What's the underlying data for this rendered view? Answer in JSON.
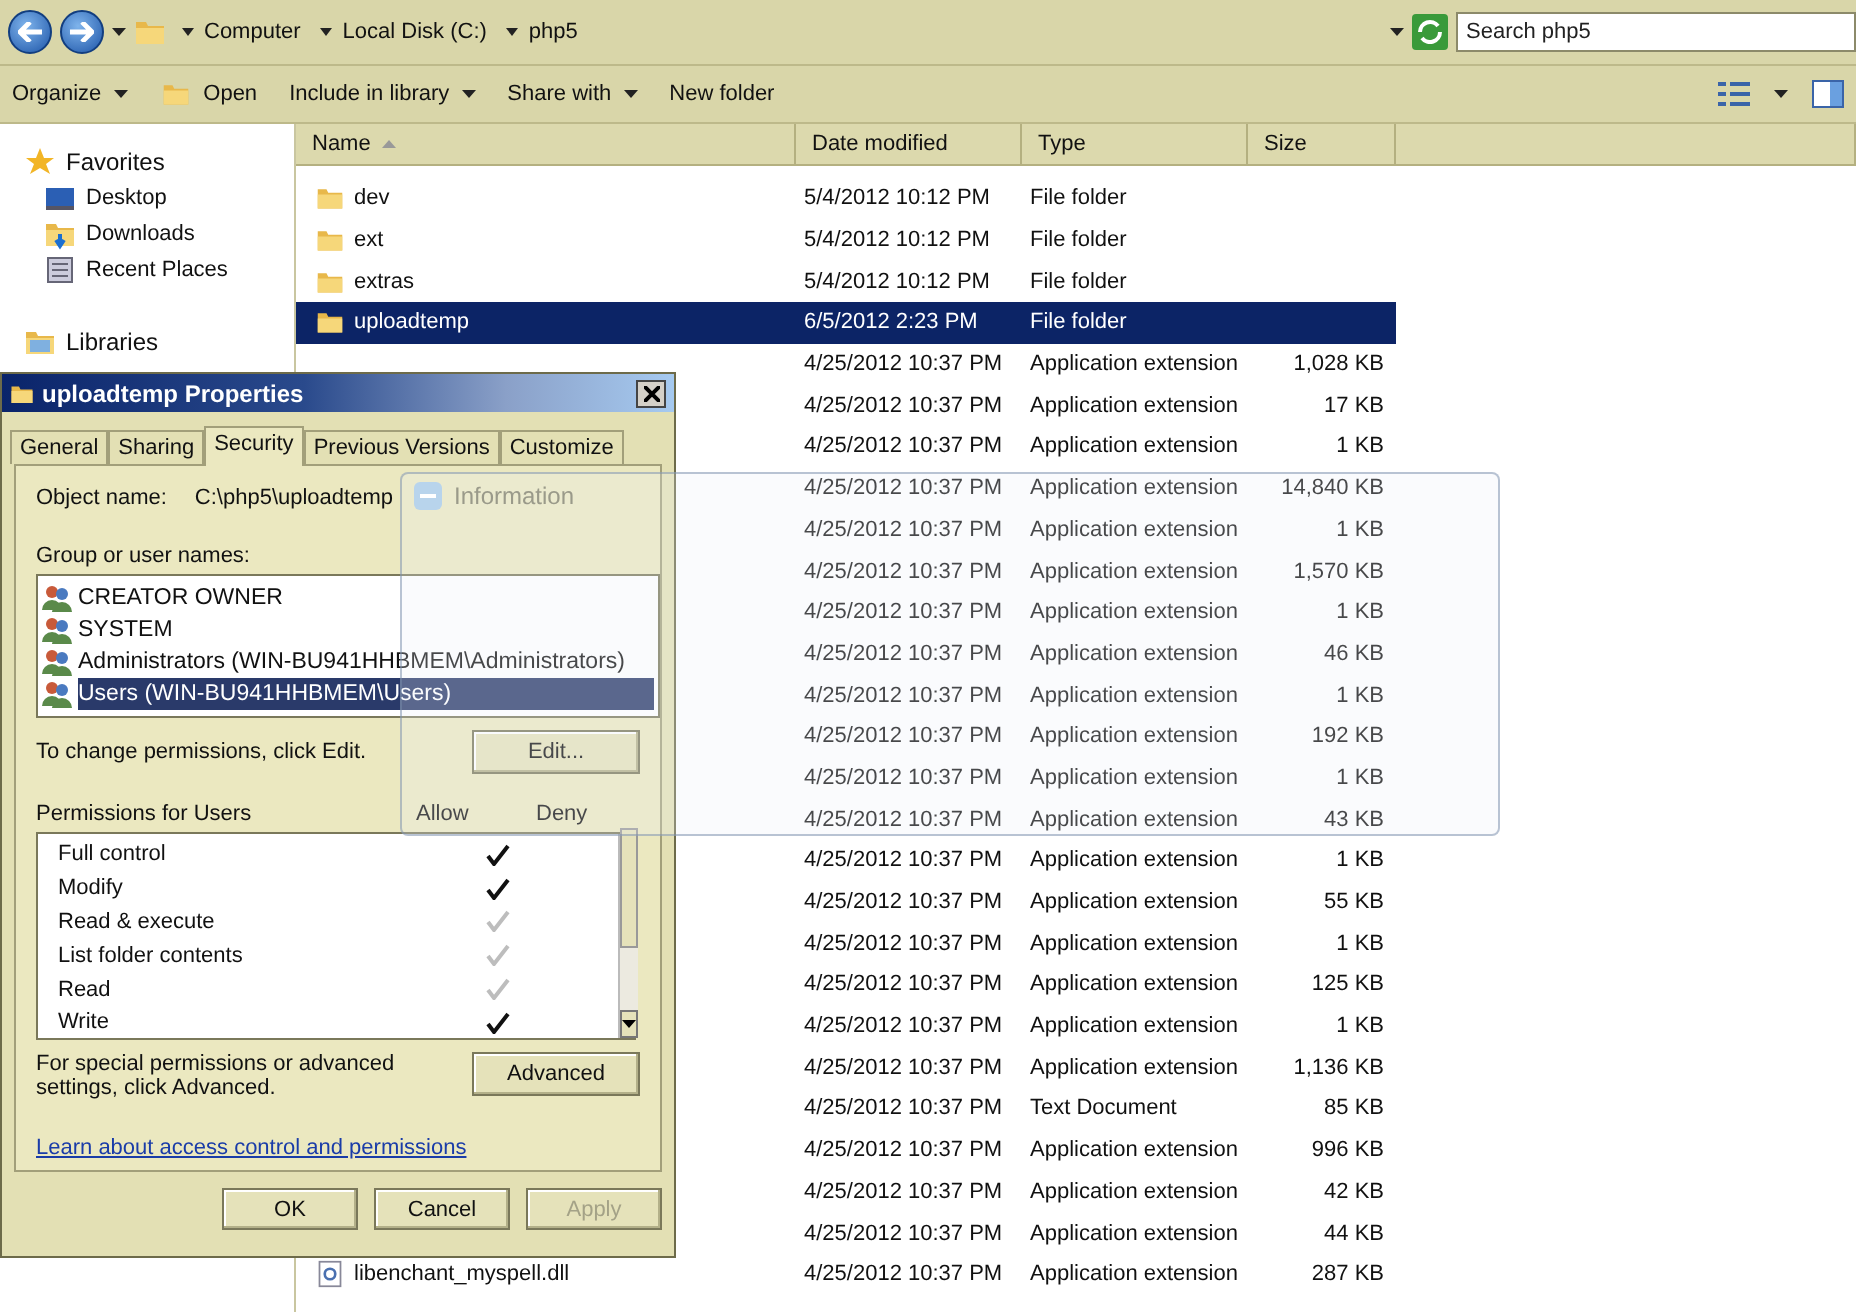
{
  "explorer": {
    "crumbs": [
      "Computer",
      "Local Disk (C:)",
      "php5"
    ],
    "search": {
      "placeholder": "Search php5"
    },
    "toolbar": [
      {
        "label": "Organize",
        "kind": "menu"
      },
      {
        "label": "Open",
        "kind": "icon"
      },
      {
        "label": "Include in library",
        "kind": "menu"
      },
      {
        "label": "Share with",
        "kind": "menu"
      },
      {
        "label": "New folder",
        "kind": "plain"
      }
    ],
    "nav": [
      {
        "label": "Favorites",
        "kind": "group"
      },
      {
        "label": "Desktop",
        "kind": "item"
      },
      {
        "label": "Downloads",
        "kind": "item"
      },
      {
        "label": "Recent Places",
        "kind": "item"
      },
      {
        "label": "Libraries",
        "kind": "group"
      }
    ],
    "columns": [
      {
        "label": "Name",
        "sorted": true
      },
      {
        "label": "Date modified",
        "sorted": false
      },
      {
        "label": "Type",
        "sorted": false
      },
      {
        "label": "Size",
        "sorted": false
      }
    ],
    "rows": [
      {
        "name": "dev",
        "kind": "folder",
        "date": "5/4/2012 10:12 PM",
        "type": "File folder",
        "selected": false
      },
      {
        "name": "ext",
        "kind": "folder",
        "date": "5/4/2012 10:12 PM",
        "type": "File folder",
        "selected": false
      },
      {
        "name": "extras",
        "kind": "folder",
        "date": "5/4/2012 10:12 PM",
        "type": "File folder",
        "selected": false
      },
      {
        "name": "uploadtemp",
        "kind": "folder",
        "date": "6/5/2012 2:23 PM",
        "type": "File folder",
        "selected": true
      },
      {
        "date": "4/25/2012 10:37 PM",
        "type": "Application extension",
        "size": "1,028 KB",
        "selected": false
      },
      {
        "date": "4/25/2012 10:37 PM",
        "type": "Application extension",
        "size": "17 KB",
        "selected": false
      },
      {
        "date": "4/25/2012 10:37 PM",
        "type": "Application extension",
        "size": "1 KB",
        "selected": false
      },
      {
        "date": "4/25/2012 10:37 PM",
        "type": "Application extension",
        "size": "14,840 KB",
        "selected": false
      },
      {
        "date": "4/25/2012 10:37 PM",
        "type": "Application extension",
        "size": "1 KB",
        "selected": false
      },
      {
        "date": "4/25/2012 10:37 PM",
        "type": "Application extension",
        "size": "1,570 KB",
        "selected": false
      },
      {
        "date": "4/25/2012 10:37 PM",
        "type": "Application extension",
        "size": "1 KB",
        "selected": false
      },
      {
        "date": "4/25/2012 10:37 PM",
        "type": "Application extension",
        "size": "46 KB",
        "selected": false
      },
      {
        "date": "4/25/2012 10:37 PM",
        "type": "Application extension",
        "size": "1 KB",
        "selected": false
      },
      {
        "date": "4/25/2012 10:37 PM",
        "type": "Application extension",
        "size": "192 KB",
        "selected": false
      },
      {
        "date": "4/25/2012 10:37 PM",
        "type": "Application extension",
        "size": "1 KB",
        "selected": false
      },
      {
        "date": "4/25/2012 10:37 PM",
        "type": "Application extension",
        "size": "43 KB",
        "selected": false
      },
      {
        "date": "4/25/2012 10:37 PM",
        "type": "Application extension",
        "size": "1 KB",
        "selected": false
      },
      {
        "date": "4/25/2012 10:37 PM",
        "type": "Application extension",
        "size": "55 KB",
        "selected": false
      },
      {
        "date": "4/25/2012 10:37 PM",
        "type": "Application extension",
        "size": "1 KB",
        "selected": false
      },
      {
        "date": "4/25/2012 10:37 PM",
        "type": "Application extension",
        "size": "125 KB",
        "selected": false
      },
      {
        "date": "4/25/2012 10:37 PM",
        "type": "Application extension",
        "size": "1 KB",
        "selected": false
      },
      {
        "date": "4/25/2012 10:37 PM",
        "type": "Application extension",
        "size": "1,136 KB",
        "selected": false
      },
      {
        "date": "4/25/2012 10:37 PM",
        "type": "Text Document",
        "size": "85 KB",
        "selected": false
      },
      {
        "date": "4/25/2012 10:37 PM",
        "type": "Application extension",
        "size": "996 KB",
        "selected": false
      },
      {
        "date": "4/25/2012 10:37 PM",
        "type": "Application extension",
        "size": "42 KB",
        "selected": false
      },
      {
        "date": "4/25/2012 10:37 PM",
        "type": "Application extension",
        "size": "44 KB",
        "selected": false
      },
      {
        "name": "libenchant_myspell.dll",
        "kind": "dll",
        "date": "4/25/2012 10:37 PM",
        "type": "Application extension",
        "size": "287 KB",
        "selected": false
      }
    ]
  },
  "properties": {
    "title": "uploadtemp Properties",
    "tabs": [
      {
        "label": "General",
        "selected": false
      },
      {
        "label": "Sharing",
        "selected": false
      },
      {
        "label": "Security",
        "selected": true
      },
      {
        "label": "Previous Versions",
        "selected": false
      },
      {
        "label": "Customize",
        "selected": false
      }
    ],
    "object_label": "Object name:",
    "object_value": "C:\\php5\\uploadtemp",
    "group_label": "Group or user names:",
    "users": [
      {
        "name": "CREATOR OWNER",
        "selected": false
      },
      {
        "name": "SYSTEM",
        "selected": false
      },
      {
        "name": "Administrators (WIN-BU941HHBMEM\\Administrators)",
        "selected": false
      },
      {
        "name": "Users (WIN-BU941HHBMEM\\Users)",
        "selected": true
      }
    ],
    "change_hint": "To change permissions, click Edit.",
    "edit_button": "Edit...",
    "permissions_label": "Permissions for Users",
    "allow_header": "Allow",
    "deny_header": "Deny",
    "permissions": [
      {
        "name": "Full control",
        "allow": true,
        "inherited": false,
        "deny": false
      },
      {
        "name": "Modify",
        "allow": true,
        "inherited": false,
        "deny": false
      },
      {
        "name": "Read & execute",
        "allow": true,
        "inherited": true,
        "deny": false
      },
      {
        "name": "List folder contents",
        "allow": true,
        "inherited": true,
        "deny": false
      },
      {
        "name": "Read",
        "allow": true,
        "inherited": true,
        "deny": false
      },
      {
        "name": "Write",
        "allow": true,
        "inherited": false,
        "deny": false
      }
    ],
    "advanced_hint": "For special permissions or advanced settings, click Advanced.",
    "advanced_button": "Advanced",
    "link": "Learn about access control and permissions",
    "buttons": [
      {
        "label": "OK",
        "disabled": false
      },
      {
        "label": "Cancel",
        "disabled": false
      },
      {
        "label": "Apply",
        "disabled": true
      }
    ]
  },
  "information": {
    "title": "Information"
  }
}
